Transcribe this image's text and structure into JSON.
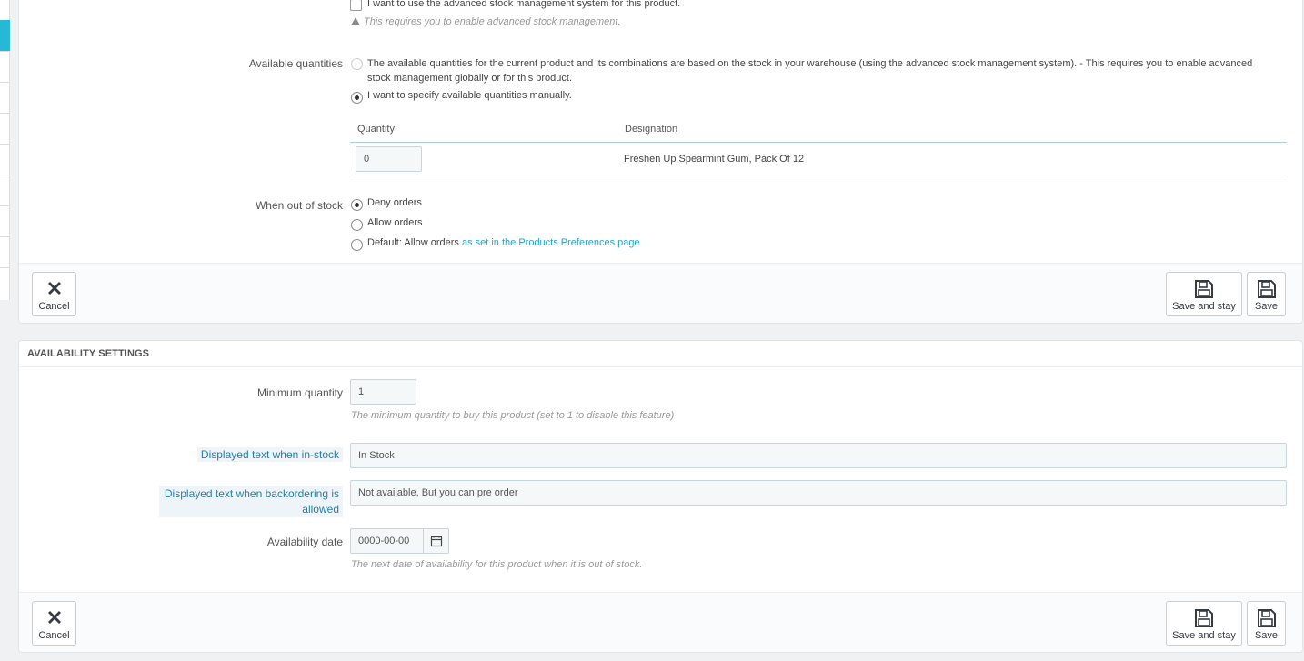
{
  "stock": {
    "advanced_checkbox_label": "I want to use the advanced stock management system for this product.",
    "advanced_warning": "This requires you to enable advanced stock management.",
    "available_quantities_label": "Available quantities",
    "option_warehouse_line1": "The available quantities for the current product and its combinations are based on the stock in your warehouse (using the advanced stock management system).  - This requires you to enable advanced",
    "option_warehouse_line2": "stock management globally or for this product.",
    "option_manual": "I want to specify available quantities manually.",
    "table": {
      "col_quantity": "Quantity",
      "col_designation": "Designation",
      "row_quantity": "0",
      "row_designation": "Freshen Up Spearmint Gum, Pack Of 12"
    },
    "out_of_stock_label": "When out of stock",
    "out_of_stock_options": {
      "deny": "Deny orders",
      "allow": "Allow orders",
      "default_prefix": "Default: Allow orders",
      "default_link": "as set in the Products Preferences page"
    },
    "selected_out_of_stock": "Deny orders"
  },
  "buttons": {
    "cancel": "Cancel",
    "save_and_stay": "Save and stay",
    "save": "Save"
  },
  "availability": {
    "heading": "AVAILABILITY SETTINGS",
    "min_qty_label": "Minimum quantity",
    "min_qty_value": "1",
    "min_qty_help": "The minimum quantity to buy this product (set to 1 to disable this feature)",
    "in_stock_label": "Displayed text when in-stock",
    "in_stock_value": "In Stock",
    "backorder_label_line1": "Displayed text when backordering is",
    "backorder_label_line2": "allowed",
    "backorder_value": "Not available, But you can pre order",
    "date_label": "Availability date",
    "date_value": "0000-00-00",
    "date_help": "The next date of availability for this product when it is out of stock."
  },
  "icons": {
    "cancel": "close-icon",
    "save": "floppy-disk-icon",
    "calendar": "calendar-icon",
    "warning": "warning-icon"
  },
  "colors": {
    "accent": "#25b9d7",
    "link": "#25a4c7",
    "hint_label": "#2a7da3"
  }
}
